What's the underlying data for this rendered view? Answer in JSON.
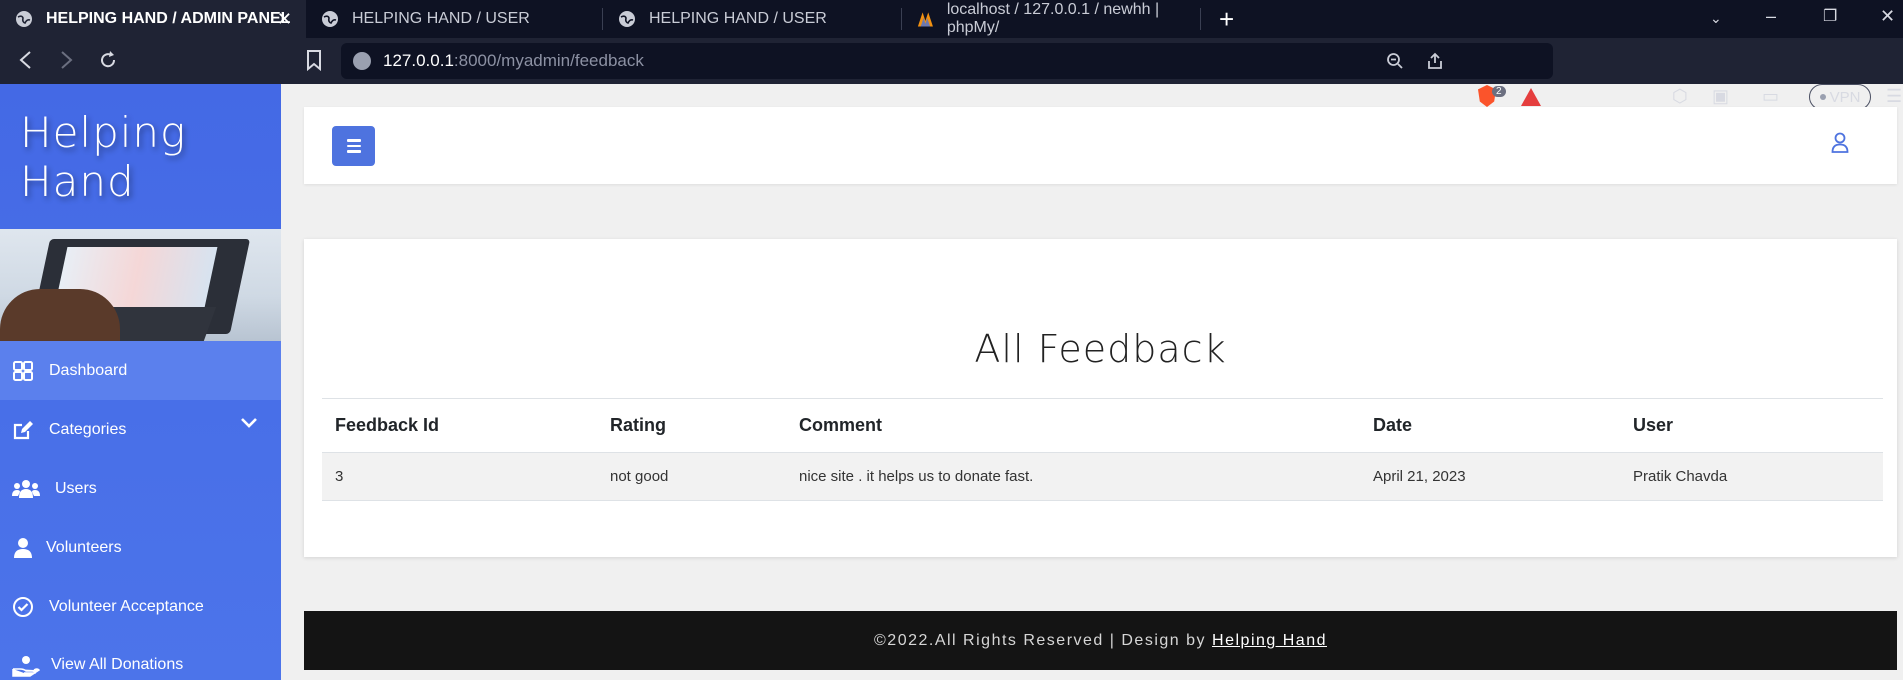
{
  "browser": {
    "tabs": [
      {
        "title": "HELPING HAND / ADMIN PANEL",
        "active": true,
        "icon": "globe-icon"
      },
      {
        "title": "HELPING HAND / USER",
        "active": false,
        "icon": "globe-icon"
      },
      {
        "title": "HELPING HAND / USER",
        "active": false,
        "icon": "globe-icon"
      },
      {
        "title": "localhost / 127.0.0.1 / newhh | phpMy/",
        "active": false,
        "icon": "phpmyadmin-icon"
      }
    ],
    "url_host": "127.0.0.1",
    "url_rest": ":8000/myadmin/feedback",
    "brave_shield_count": "2",
    "vpn_label": "VPN"
  },
  "sidebar": {
    "brand_line1": "Helping",
    "brand_line2": "Hand",
    "items": [
      {
        "label": "Dashboard",
        "icon": "dashboard-icon",
        "active": true
      },
      {
        "label": "Categories",
        "icon": "edit-icon",
        "has_submenu": true
      },
      {
        "label": "Users",
        "icon": "users-icon"
      },
      {
        "label": "Volunteers",
        "icon": "user-icon"
      },
      {
        "label": "Volunteer Acceptance",
        "icon": "check-circle-icon"
      },
      {
        "label": "View All Donations",
        "icon": "donation-hand-icon"
      }
    ]
  },
  "main": {
    "title": "All Feedback",
    "table": {
      "headers": [
        "Feedback Id",
        "Rating",
        "Comment",
        "Date",
        "User"
      ],
      "rows": [
        [
          "3",
          "not good",
          "nice site . it helps us to donate fast.",
          "April 21, 2023",
          "Pratik Chavda"
        ]
      ]
    }
  },
  "footer": {
    "text": "©2022.All Rights Reserved | Design by",
    "link": "Helping Hand"
  },
  "colors": {
    "accent": "#4e73df",
    "sidebar": "#4a70e8",
    "footer_bg": "#141414"
  }
}
